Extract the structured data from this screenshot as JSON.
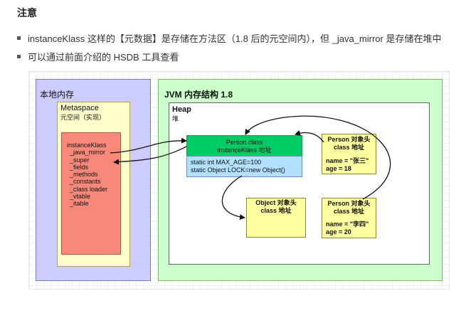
{
  "note": {
    "heading": "注意",
    "bullets": [
      "instanceKlass 这样的【元数据】是存储在方法区（1.8 后的元空间内），但 _java_mirror 是存储在堆中",
      "可以通过前面介绍的 HSDB 工具查看"
    ]
  },
  "diagram": {
    "native_memory": "本地内存",
    "jvm_memory": "JVM 内存结构 1.8",
    "metaspace": {
      "title": "Metaspace",
      "subtitle": "元空间（实现）"
    },
    "heap": {
      "title": "Heap",
      "subtitle": "堆"
    },
    "instance_klass": {
      "title": "instanceKlass",
      "fields": [
        "_java_mirror",
        "_super",
        "_fields",
        "_methods",
        "_constants",
        "_class loader",
        "_vtable",
        "_itable"
      ]
    },
    "person_class": {
      "line1": "Person.class",
      "line2": "instanceKlass 地址",
      "field1": "static int  MAX_AGE=100",
      "field2": "static Object LOCK=new Object()"
    },
    "person1": {
      "line1": "Person 对象头",
      "line2": "class 地址",
      "name": "name = \"张三\"",
      "age": "age = 18"
    },
    "object_header": {
      "line1": "Object 对象头",
      "line2": "class 地址"
    },
    "person2": {
      "line1": "Person 对象头",
      "line2": "class 地址",
      "name": "name = \"李四\"",
      "age": "age = 20"
    },
    "colors": {
      "native": "#ccccff",
      "jvm": "#ccffcc",
      "metaspace": "#ffffcc",
      "klass": "#f8887a",
      "class_head": "#00cc66",
      "class_body": "#b3e0ff",
      "object": "#ffffa0"
    }
  }
}
